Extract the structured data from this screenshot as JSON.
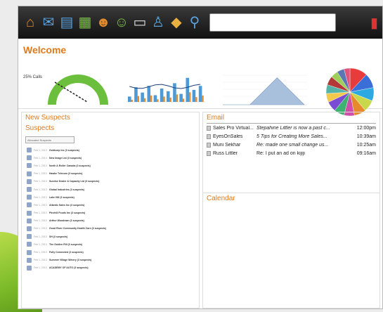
{
  "toolbar": {
    "icons": [
      "home-icon",
      "mail-icon",
      "database-icon",
      "calendar-icon",
      "users-icon",
      "contacts-icon",
      "presentation-icon",
      "person-icon",
      "tag-icon",
      "binoculars-icon"
    ],
    "search_value": "",
    "right_icon": "exit-icon"
  },
  "welcome": {
    "title": "Welcome",
    "gauge_label": "25% Calls"
  },
  "chart_data": [
    {
      "type": "gauge",
      "label": "25% Calls",
      "value": 25,
      "color": "#6cbf3c"
    },
    {
      "type": "bar",
      "values": [
        20,
        55,
        35,
        60,
        25,
        50,
        40,
        70,
        30,
        90,
        45,
        60
      ],
      "color": "#4d9ad6"
    },
    {
      "type": "area",
      "values": [
        0,
        0,
        80,
        0
      ],
      "color": "#a9c0dd"
    },
    {
      "type": "pie",
      "values": [
        12,
        10,
        9,
        8,
        8,
        7,
        7,
        7,
        6,
        6,
        6,
        5,
        5,
        4
      ],
      "colors": [
        "#e83b3b",
        "#3a6fd8",
        "#2ca9e1",
        "#c8d84a",
        "#e68a2b",
        "#d04ea8",
        "#3cb371",
        "#7a4cd4",
        "#f2c94c",
        "#56b3a8",
        "#b33939",
        "#9ecf5a",
        "#5a77b3",
        "#e0557a"
      ]
    }
  ],
  "left_pane": {
    "new_suspects_title": "New Suspects",
    "suspects_title": "Suspects",
    "select_value": "Allocated Suspects",
    "rows": [
      {
        "date": "Feb 1, 2013",
        "name": "Goldcorp Inc (3 suspects)"
      },
      {
        "date": "Feb 1, 2013",
        "name": "New Image Ltd (3 suspects)"
      },
      {
        "date": "Feb 1, 2013",
        "name": "North & Roller Canada (3 suspects)"
      },
      {
        "date": "Feb 1, 2013",
        "name": "Hawke Telecom (3 suspects)"
      },
      {
        "date": "Feb 1, 2013",
        "name": "Sunrise Dealer & Capacity Ltd (3 suspects)"
      },
      {
        "date": "Feb 1, 2013",
        "name": "Global Industries (3 suspects)"
      },
      {
        "date": "Feb 1, 2013",
        "name": "Lake Hill (3 suspects)"
      },
      {
        "date": "Feb 1, 2013",
        "name": "Atlantic Sales Inc (3 suspects)"
      },
      {
        "date": "Feb 1, 2013",
        "name": "Pinehill Foods Inc (3 suspects)"
      },
      {
        "date": "Feb 1, 2013",
        "name": "Arthur Woodman (3 suspects)"
      },
      {
        "date": "Feb 1, 2013",
        "name": "Good River Community Health Care (3 suspects)"
      },
      {
        "date": "Feb 1, 2013",
        "name": "SH (3 suspects)"
      },
      {
        "date": "Feb 1, 2013",
        "name": "The Golden Rill (3 suspects)"
      },
      {
        "date": "Feb 1, 2013",
        "name": "Fully Connected (3 suspects)"
      },
      {
        "date": "Feb 1, 2013",
        "name": "Summer Village Winery (3 suspects)"
      },
      {
        "date": "Feb 1, 2013",
        "name": "ACADEMY OF AUTO (3 suspects)"
      }
    ]
  },
  "email": {
    "title": "Email",
    "rows": [
      {
        "from": "Sales Pro Virtual...",
        "subject": "Stepahine Littler is now a past c...",
        "time": "12:00pm",
        "italic": true
      },
      {
        "from": "EyesOnSales",
        "subject": "5 Tips for Creating More Sales...",
        "time": "10:39am",
        "italic": true
      },
      {
        "from": "Muni Sekhar",
        "subject": "Re: made one small change us...",
        "time": "10:25am",
        "italic": true
      },
      {
        "from": "Russ Littler",
        "subject": "Re: I put an ad on kijiji",
        "time": "09:16am",
        "italic": false
      }
    ]
  },
  "calendar": {
    "title": "Calendar"
  }
}
